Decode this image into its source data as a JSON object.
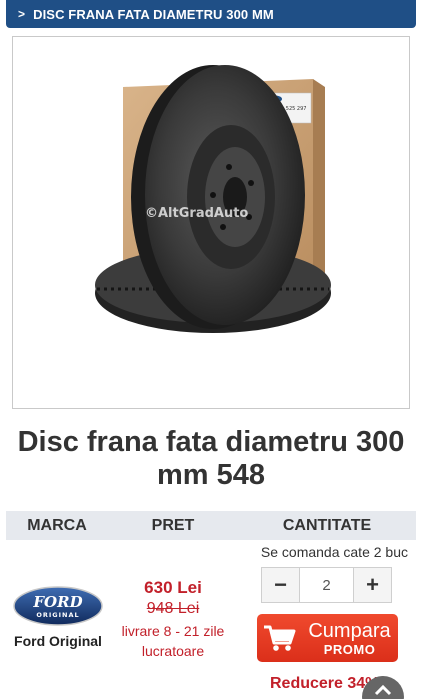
{
  "breadcrumb": {
    "chevron": ">",
    "text": "DISC FRANA FATA DIAMETRU 300 MM"
  },
  "product_image": {
    "watermark": "©AltGradAuto",
    "box_label": "1 525 297"
  },
  "product": {
    "title": "Disc frana fata diametru 300 mm 548"
  },
  "table": {
    "col_brand": "MARCA",
    "col_price": "PRET",
    "col_quantity": "CANTITATE"
  },
  "order_note": "Se comanda cate 2 buc",
  "brand": {
    "logo_top": "FORD",
    "logo_bottom": "ORIGINAL",
    "name": "Ford Original"
  },
  "price": {
    "current": "630 Lei",
    "old": "948 Lei",
    "delivery": "livrare 8 - 21 zile lucratoare"
  },
  "quantity": {
    "minus": "−",
    "value": "2",
    "plus": "+"
  },
  "buy_button": {
    "label": "Cumpara",
    "sub_label": "PROMO",
    "icon": "cart-icon"
  },
  "discount": "Reducere 34%",
  "scroll_top": {
    "icon": "chevron-up-icon"
  },
  "colors": {
    "header": "#1f4f86",
    "price_red": "#c2202a",
    "buy_button": "#e63b22",
    "table_header": "#e6e9ee"
  }
}
